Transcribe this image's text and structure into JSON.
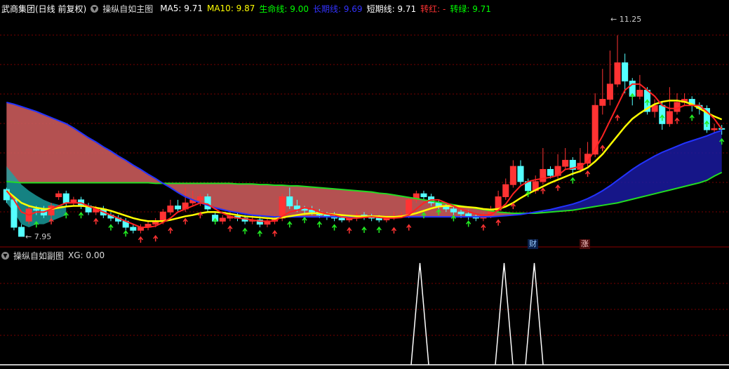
{
  "main_header": {
    "stock": "武商集团(日线 前复权)",
    "indicator": "操纵自如主图",
    "items": [
      {
        "label": "MA5: 9.71",
        "color": "#ffffff"
      },
      {
        "label": "MA10: 9.87",
        "color": "#ffff00"
      },
      {
        "label": "生命线: 9.00",
        "color": "#00ff00"
      },
      {
        "label": "长期线: 9.69",
        "color": "#3333ff"
      },
      {
        "label": "短期线: 9.71",
        "color": "#ffffff"
      },
      {
        "label": "转红: -",
        "color": "#ff3333"
      },
      {
        "label": "转绿: 9.71",
        "color": "#00ff00"
      }
    ]
  },
  "sub_header": {
    "indicator": "操纵自如副图",
    "xg": "XG: 0.00"
  },
  "price_labels": {
    "high": "11.25",
    "low": "7.95"
  },
  "badges": {
    "cai": "财",
    "zhang": "涨"
  },
  "colors": {
    "up": "#ff3333",
    "down": "#54ffff",
    "bg": "#000000",
    "grid": "#7a0000"
  },
  "chart_data": {
    "type": "candlestick",
    "candles": [
      [
        8.72,
        8.55,
        8.75,
        8.5
      ],
      [
        8.55,
        8.1,
        8.6,
        8.05
      ],
      [
        8.1,
        7.95,
        8.15,
        7.95
      ],
      [
        8.2,
        8.4,
        8.45,
        8.15
      ],
      [
        8.4,
        8.38,
        8.45,
        8.3
      ],
      [
        8.4,
        8.3,
        8.45,
        8.25
      ],
      [
        8.3,
        8.45,
        8.5,
        8.25
      ],
      [
        8.6,
        8.65,
        8.7,
        8.55
      ],
      [
        8.65,
        8.5,
        8.7,
        8.45
      ],
      [
        8.5,
        8.55,
        8.6,
        8.45
      ],
      [
        8.55,
        8.45,
        8.6,
        8.4
      ],
      [
        8.45,
        8.35,
        8.5,
        8.3
      ],
      [
        8.35,
        8.4,
        8.45,
        8.3
      ],
      [
        8.4,
        8.3,
        8.45,
        8.25
      ],
      [
        8.3,
        8.25,
        8.35,
        8.2
      ],
      [
        8.25,
        8.2,
        8.3,
        8.15
      ],
      [
        8.2,
        8.1,
        8.25,
        8.05
      ],
      [
        8.1,
        8.05,
        8.15,
        8.0
      ],
      [
        8.05,
        8.1,
        8.15,
        8.0
      ],
      [
        8.1,
        8.15,
        8.2,
        8.05
      ],
      [
        8.15,
        8.2,
        8.25,
        8.1
      ],
      [
        8.2,
        8.35,
        8.4,
        8.15
      ],
      [
        8.35,
        8.45,
        8.55,
        8.3
      ],
      [
        8.45,
        8.4,
        8.55,
        8.35
      ],
      [
        8.4,
        8.5,
        8.75,
        8.35
      ],
      [
        8.5,
        8.55,
        8.7,
        8.45
      ],
      [
        8.55,
        8.6,
        8.65,
        8.45
      ],
      [
        8.6,
        8.4,
        8.65,
        8.35
      ],
      [
        8.3,
        8.2,
        8.35,
        8.15
      ],
      [
        8.2,
        8.25,
        8.3,
        8.15
      ],
      [
        8.25,
        8.28,
        8.35,
        8.2
      ],
      [
        8.28,
        8.25,
        8.35,
        8.2
      ],
      [
        8.25,
        8.2,
        8.3,
        8.15
      ],
      [
        8.2,
        8.22,
        8.3,
        8.15
      ],
      [
        8.22,
        8.15,
        8.28,
        8.1
      ],
      [
        8.15,
        8.2,
        8.25,
        8.1
      ],
      [
        8.2,
        8.25,
        8.3,
        8.15
      ],
      [
        8.25,
        8.6,
        8.65,
        8.2
      ],
      [
        8.6,
        8.45,
        8.75,
        8.4
      ],
      [
        8.45,
        8.4,
        8.55,
        8.35
      ],
      [
        8.4,
        8.38,
        8.45,
        8.3
      ],
      [
        8.38,
        8.35,
        8.45,
        8.3
      ],
      [
        8.35,
        8.3,
        8.4,
        8.25
      ],
      [
        8.3,
        8.28,
        8.35,
        8.22
      ],
      [
        8.28,
        8.25,
        8.35,
        8.2
      ],
      [
        8.25,
        8.22,
        8.3,
        8.18
      ],
      [
        8.22,
        8.25,
        8.3,
        8.18
      ],
      [
        8.25,
        8.3,
        8.35,
        8.2
      ],
      [
        8.3,
        8.28,
        8.35,
        8.22
      ],
      [
        8.28,
        8.25,
        8.32,
        8.2
      ],
      [
        8.25,
        8.22,
        8.3,
        8.18
      ],
      [
        8.22,
        8.25,
        8.3,
        8.18
      ],
      [
        8.25,
        8.28,
        8.35,
        8.22
      ],
      [
        8.28,
        8.3,
        8.35,
        8.25
      ],
      [
        8.3,
        8.55,
        8.6,
        8.25
      ],
      [
        8.55,
        8.65,
        8.7,
        8.5
      ],
      [
        8.65,
        8.6,
        8.7,
        8.55
      ],
      [
        8.6,
        8.5,
        8.65,
        8.45
      ],
      [
        8.5,
        8.45,
        8.55,
        8.4
      ],
      [
        8.45,
        8.4,
        8.5,
        8.35
      ],
      [
        8.4,
        8.35,
        8.45,
        8.3
      ],
      [
        8.35,
        8.32,
        8.4,
        8.25
      ],
      [
        8.32,
        8.28,
        8.38,
        8.22
      ],
      [
        8.28,
        8.25,
        8.32,
        8.2
      ],
      [
        8.25,
        8.3,
        8.35,
        8.2
      ],
      [
        8.3,
        8.38,
        8.45,
        8.25
      ],
      [
        8.38,
        8.6,
        8.7,
        8.35
      ],
      [
        8.6,
        8.8,
        8.9,
        8.55
      ],
      [
        8.8,
        9.1,
        9.2,
        8.75
      ],
      [
        9.1,
        8.85,
        9.2,
        8.8
      ],
      [
        8.85,
        8.7,
        8.9,
        8.65
      ],
      [
        8.7,
        8.85,
        8.95,
        8.65
      ],
      [
        8.85,
        9.05,
        9.4,
        8.8
      ],
      [
        9.05,
        8.95,
        9.1,
        8.9
      ],
      [
        8.95,
        9.1,
        9.3,
        8.9
      ],
      [
        9.1,
        9.2,
        9.4,
        9.05
      ],
      [
        9.2,
        9.05,
        9.25,
        8.95
      ],
      [
        9.05,
        9.15,
        9.4,
        9.0
      ],
      [
        9.15,
        9.3,
        9.5,
        9.1
      ],
      [
        9.3,
        10.1,
        10.3,
        9.25
      ],
      [
        10.1,
        10.2,
        10.7,
        9.95
      ],
      [
        10.2,
        10.45,
        11.0,
        10.1
      ],
      [
        10.45,
        10.8,
        11.25,
        10.4
      ],
      [
        10.8,
        10.5,
        10.95,
        10.3
      ],
      [
        10.5,
        10.25,
        10.55,
        10.1
      ],
      [
        10.25,
        10.35,
        10.6,
        10.2
      ],
      [
        10.35,
        10.0,
        10.4,
        9.95
      ],
      [
        10.0,
        10.1,
        10.2,
        9.9
      ],
      [
        10.1,
        9.8,
        10.15,
        9.7
      ],
      [
        9.8,
        10.0,
        10.4,
        9.75
      ],
      [
        10.0,
        10.15,
        10.3,
        9.95
      ],
      [
        10.15,
        10.2,
        10.3,
        10.1
      ],
      [
        10.2,
        10.1,
        10.25,
        10.0
      ],
      [
        10.1,
        10.05,
        10.15,
        9.95
      ],
      [
        10.05,
        9.7,
        10.1,
        9.65
      ],
      [
        9.7,
        9.72,
        9.8,
        9.65
      ],
      [
        9.72,
        9.71,
        9.78,
        9.62
      ]
    ],
    "ma5": [
      8.7,
      8.55,
      8.35,
      8.3,
      8.35,
      8.35,
      8.4,
      8.45,
      8.5,
      8.5,
      8.5,
      8.45,
      8.4,
      8.35,
      8.3,
      8.25,
      8.2,
      8.15,
      8.1,
      8.1,
      8.12,
      8.18,
      8.25,
      8.35,
      8.4,
      8.45,
      8.5,
      8.48,
      8.4,
      8.33,
      8.28,
      8.25,
      8.24,
      8.22,
      8.2,
      8.2,
      8.2,
      8.28,
      8.35,
      8.38,
      8.42,
      8.4,
      8.35,
      8.32,
      8.3,
      8.27,
      8.25,
      8.25,
      8.26,
      8.27,
      8.26,
      8.25,
      8.25,
      8.26,
      8.3,
      8.4,
      8.5,
      8.55,
      8.55,
      8.5,
      8.45,
      8.4,
      8.36,
      8.32,
      8.3,
      8.31,
      8.38,
      8.48,
      8.65,
      8.78,
      8.85,
      8.88,
      8.9,
      8.92,
      8.95,
      9.05,
      9.07,
      9.1,
      9.18,
      9.38,
      9.6,
      9.85,
      10.1,
      10.35,
      10.45,
      10.45,
      10.35,
      10.25,
      10.1,
      10.05,
      10.05,
      10.1,
      10.1,
      10.1,
      10.0,
      9.88,
      9.71
    ],
    "ma10": [
      8.7,
      8.6,
      8.5,
      8.45,
      8.42,
      8.4,
      8.4,
      8.42,
      8.44,
      8.45,
      8.45,
      8.44,
      8.42,
      8.4,
      8.37,
      8.33,
      8.29,
      8.25,
      8.22,
      8.2,
      8.2,
      8.2,
      8.22,
      8.25,
      8.28,
      8.3,
      8.33,
      8.35,
      8.35,
      8.34,
      8.32,
      8.3,
      8.28,
      8.27,
      8.26,
      8.25,
      8.24,
      8.26,
      8.28,
      8.3,
      8.32,
      8.33,
      8.33,
      8.32,
      8.31,
      8.3,
      8.29,
      8.28,
      8.28,
      8.28,
      8.28,
      8.27,
      8.27,
      8.28,
      8.3,
      8.33,
      8.37,
      8.41,
      8.44,
      8.45,
      8.45,
      8.44,
      8.43,
      8.42,
      8.4,
      8.39,
      8.4,
      8.44,
      8.5,
      8.58,
      8.65,
      8.71,
      8.77,
      8.83,
      8.88,
      8.93,
      8.98,
      9.02,
      9.08,
      9.18,
      9.3,
      9.45,
      9.6,
      9.75,
      9.88,
      9.97,
      10.05,
      10.12,
      10.16,
      10.18,
      10.18,
      10.16,
      10.12,
      10.05,
      9.98,
      9.92,
      9.87
    ],
    "lifeline": [
      8.85,
      8.84,
      8.83,
      8.83,
      8.83,
      8.83,
      8.83,
      8.83,
      8.83,
      8.83,
      8.83,
      8.83,
      8.83,
      8.83,
      8.83,
      8.83,
      8.83,
      8.83,
      8.83,
      8.83,
      8.82,
      8.82,
      8.82,
      8.82,
      8.82,
      8.82,
      8.82,
      8.82,
      8.82,
      8.82,
      8.82,
      8.81,
      8.81,
      8.81,
      8.8,
      8.8,
      8.79,
      8.79,
      8.78,
      8.78,
      8.77,
      8.76,
      8.75,
      8.74,
      8.73,
      8.72,
      8.71,
      8.7,
      8.69,
      8.68,
      8.66,
      8.65,
      8.63,
      8.61,
      8.59,
      8.57,
      8.55,
      8.53,
      8.51,
      8.49,
      8.47,
      8.45,
      8.43,
      8.41,
      8.39,
      8.37,
      8.35,
      8.34,
      8.33,
      8.33,
      8.33,
      8.33,
      8.34,
      8.35,
      8.36,
      8.37,
      8.38,
      8.4,
      8.42,
      8.44,
      8.46,
      8.48,
      8.5,
      8.53,
      8.56,
      8.59,
      8.62,
      8.65,
      8.68,
      8.71,
      8.74,
      8.77,
      8.8,
      8.83,
      8.87,
      8.94,
      9.0
    ],
    "longline": [
      10.15,
      10.12,
      10.08,
      10.04,
      10.0,
      9.95,
      9.9,
      9.85,
      9.8,
      9.73,
      9.65,
      9.57,
      9.5,
      9.42,
      9.35,
      9.27,
      9.2,
      9.12,
      9.05,
      8.97,
      8.9,
      8.82,
      8.75,
      8.67,
      8.6,
      8.55,
      8.5,
      8.46,
      8.42,
      8.39,
      8.36,
      8.34,
      8.32,
      8.3,
      8.29,
      8.28,
      8.27,
      8.27,
      8.27,
      8.27,
      8.27,
      8.27,
      8.27,
      8.27,
      8.27,
      8.27,
      8.27,
      8.27,
      8.27,
      8.27,
      8.27,
      8.27,
      8.27,
      8.27,
      8.27,
      8.27,
      8.27,
      8.27,
      8.27,
      8.27,
      8.27,
      8.27,
      8.27,
      8.27,
      8.27,
      8.27,
      8.28,
      8.29,
      8.3,
      8.31,
      8.33,
      8.35,
      8.37,
      8.39,
      8.42,
      8.45,
      8.48,
      8.52,
      8.57,
      8.63,
      8.7,
      8.78,
      8.87,
      8.96,
      9.05,
      9.13,
      9.2,
      9.27,
      9.33,
      9.38,
      9.43,
      9.48,
      9.52,
      9.56,
      9.6,
      9.65,
      9.69
    ],
    "xg": [
      0,
      0,
      0,
      0,
      0,
      0,
      0,
      0,
      0,
      0,
      0,
      0,
      0,
      0,
      0,
      0,
      0,
      0,
      0,
      0,
      0,
      0,
      0,
      0,
      0,
      0,
      0,
      0,
      0,
      0,
      0,
      0,
      0,
      0,
      0,
      0,
      0,
      0,
      0,
      0,
      0,
      0,
      0,
      0,
      0,
      0,
      0,
      0,
      0,
      0,
      0,
      0,
      0,
      0,
      0,
      0,
      0,
      0,
      0,
      0,
      0,
      0,
      0,
      0,
      0,
      0,
      0,
      0,
      0,
      0,
      0,
      0,
      0,
      0,
      0,
      0,
      0,
      0,
      0,
      0,
      0,
      0,
      0,
      0,
      0,
      0,
      0,
      0,
      0,
      0,
      0,
      0,
      0,
      0,
      0,
      0,
      0,
      0,
      0,
      0
    ],
    "ylim": [
      7.8,
      11.6
    ]
  }
}
